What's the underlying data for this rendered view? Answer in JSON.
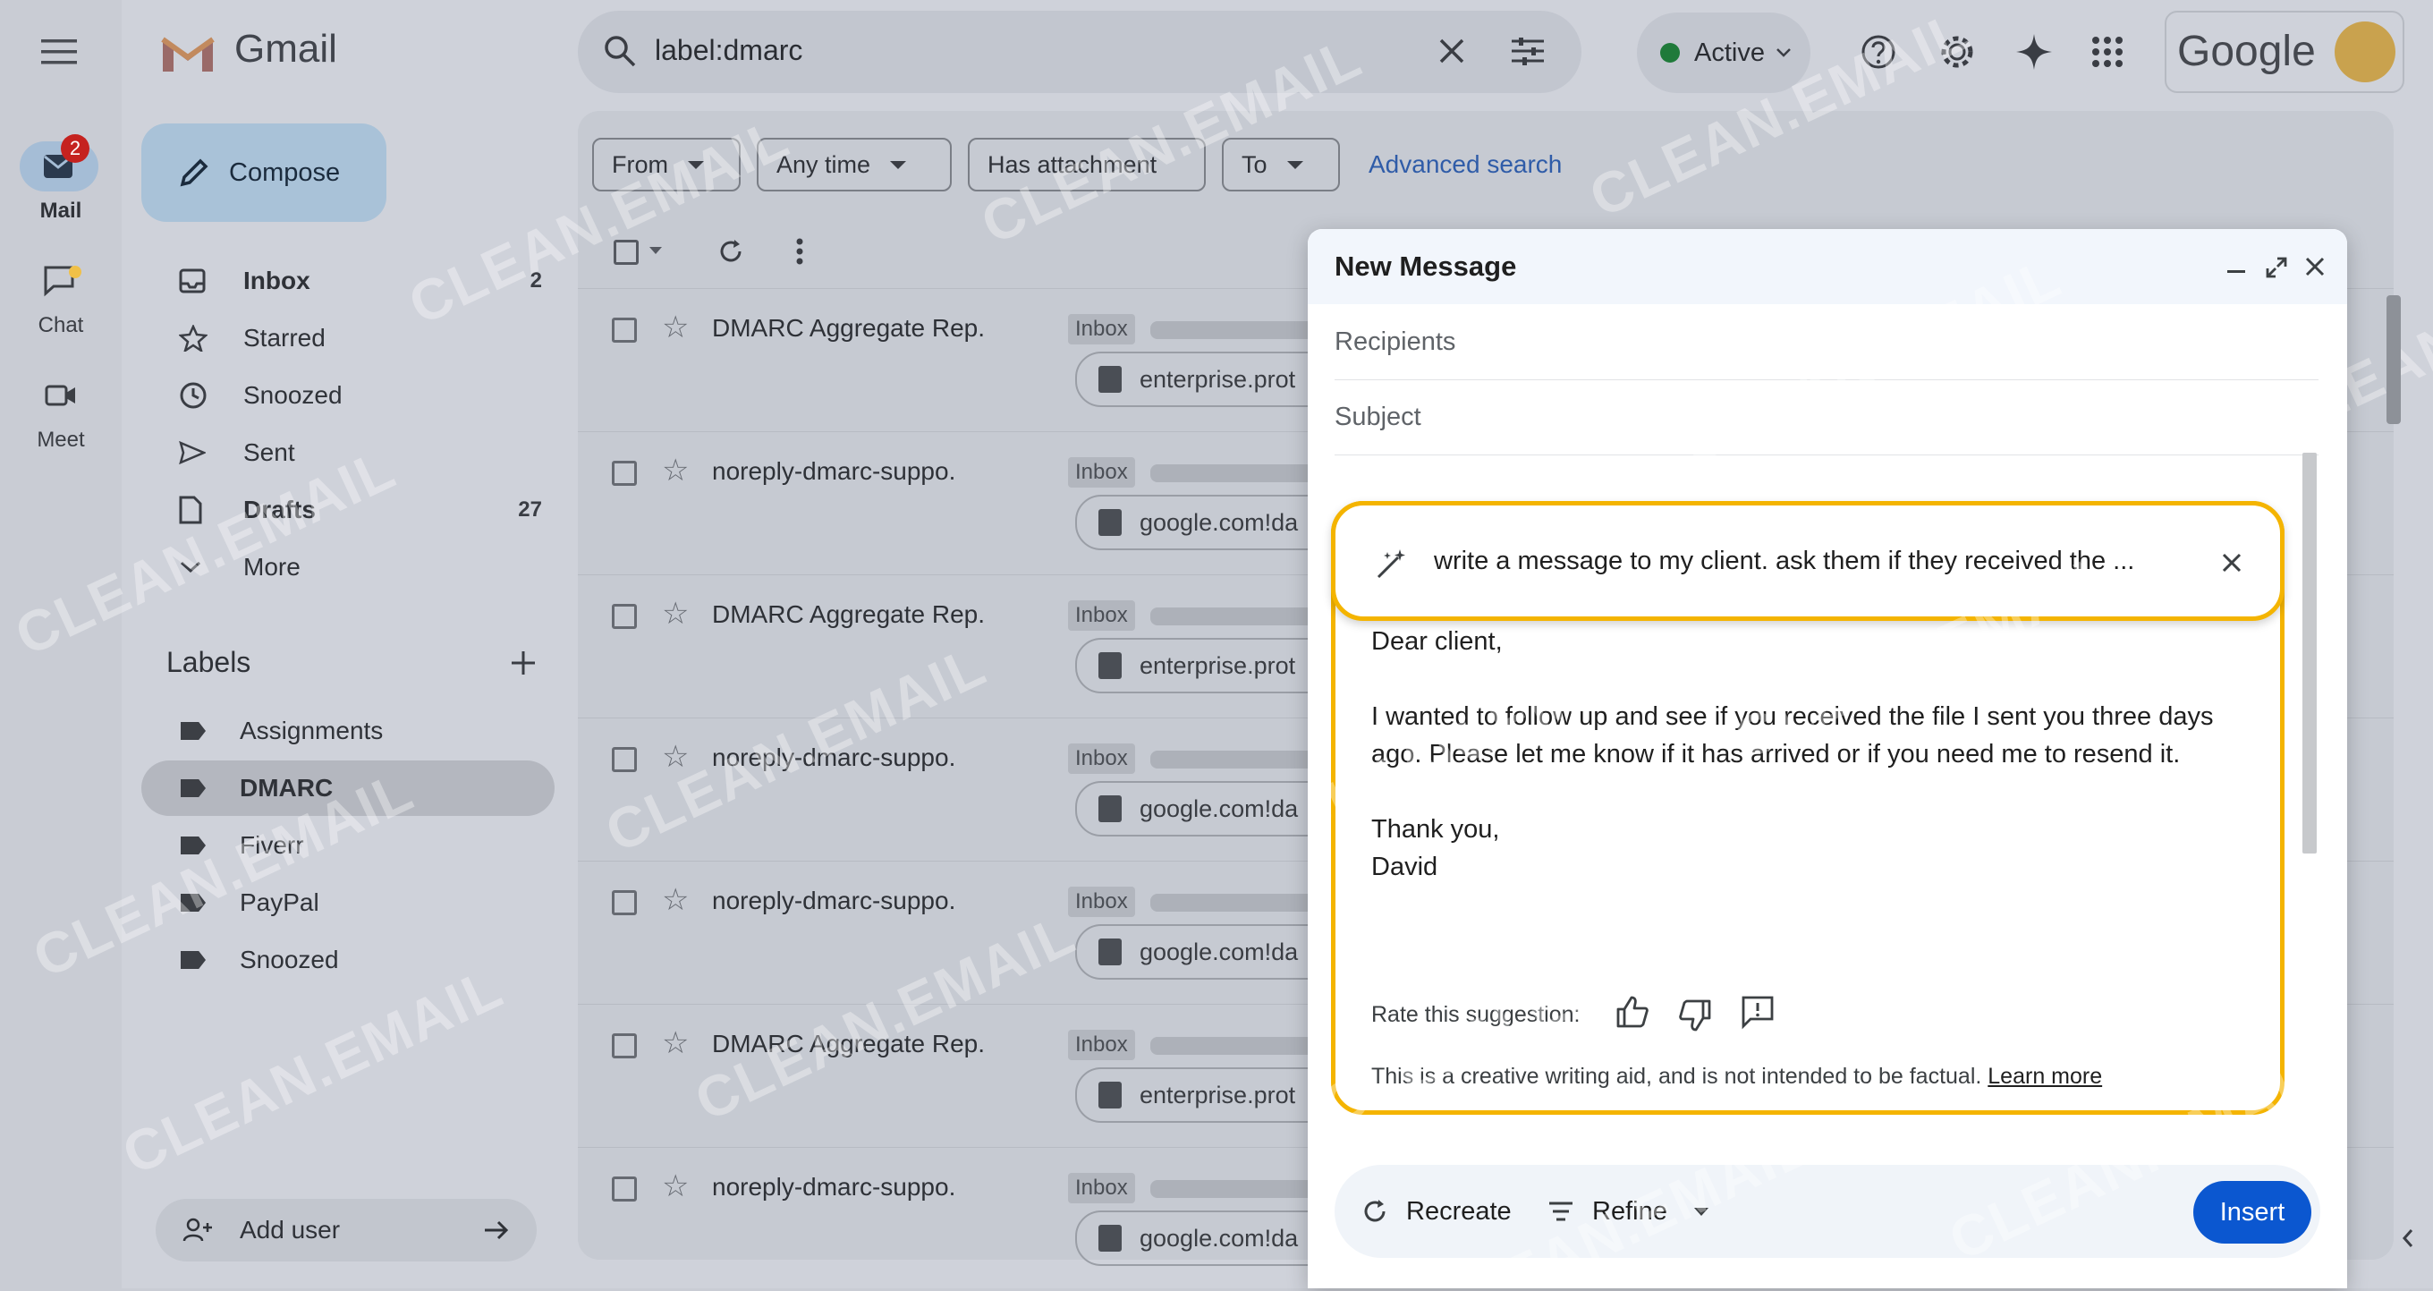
{
  "app": {
    "name": "Gmail",
    "brand": "Google"
  },
  "colors": {
    "ai_highlight": "#f4b400",
    "primary": "#0b57d0",
    "dim_overlay": "#cfd2da"
  },
  "rail": {
    "items": [
      {
        "label": "Mail",
        "icon": "mail-icon",
        "badge": "2"
      },
      {
        "label": "Chat",
        "icon": "chat-icon"
      },
      {
        "label": "Meet",
        "icon": "video-icon"
      }
    ]
  },
  "sidebar": {
    "compose_label": "Compose",
    "nav": [
      {
        "label": "Inbox",
        "icon": "inbox-icon",
        "count": "2"
      },
      {
        "label": "Starred",
        "icon": "star-icon",
        "count": ""
      },
      {
        "label": "Snoozed",
        "icon": "clock-icon",
        "count": ""
      },
      {
        "label": "Sent",
        "icon": "send-icon",
        "count": ""
      },
      {
        "label": "Drafts",
        "icon": "draft-icon",
        "count": "27"
      },
      {
        "label": "More",
        "icon": "chevron-down-icon",
        "count": ""
      }
    ],
    "labels_title": "Labels",
    "labels": [
      "Assignments",
      "DMARC",
      "Fiverr",
      "PayPal",
      "Snoozed"
    ],
    "add_user": "Add user"
  },
  "search": {
    "query": "label:dmarc"
  },
  "status": {
    "label": "Active"
  },
  "filters": {
    "from": "From",
    "any_time": "Any time",
    "has_attachment": "Has attachment",
    "to": "To",
    "advanced": "Advanced search"
  },
  "emails": [
    {
      "sender": "DMARC Aggregate Rep.",
      "badge": "Inbox",
      "attachment": "enterprise.prot"
    },
    {
      "sender": "noreply-dmarc-suppo.",
      "badge": "Inbox",
      "attachment": "google.com!da"
    },
    {
      "sender": "DMARC Aggregate Rep.",
      "badge": "Inbox",
      "attachment": "enterprise.prot"
    },
    {
      "sender": "noreply-dmarc-suppo.",
      "badge": "Inbox",
      "attachment": "google.com!da"
    },
    {
      "sender": "noreply-dmarc-suppo.",
      "badge": "Inbox",
      "attachment": "google.com!da"
    },
    {
      "sender": "DMARC Aggregate Rep.",
      "badge": "Inbox",
      "attachment": "enterprise.prot"
    },
    {
      "sender": "noreply-dmarc-suppo.",
      "badge": "Inbox",
      "attachment": "google.com!da"
    }
  ],
  "compose": {
    "title": "New Message",
    "recipients_placeholder": "Recipients",
    "subject_placeholder": "Subject",
    "prompt": "write a message to my client. ask them if they received the ...",
    "body": {
      "greeting": "Dear client,",
      "line1": "I wanted to follow up and see if you received the file I sent you three days",
      "line2": "ago. Please let me know if it has arrived or if you need me to resend it.",
      "closing": "Thank you,",
      "signature": "David"
    },
    "rate_label": "Rate this suggestion:",
    "disclaimer": "This is a creative writing aid, and is not intended to be factual.",
    "learn_more": "Learn more",
    "recreate": "Recreate",
    "refine": "Refine",
    "insert": "Insert"
  },
  "watermark": "CLEAN.EMAIL"
}
